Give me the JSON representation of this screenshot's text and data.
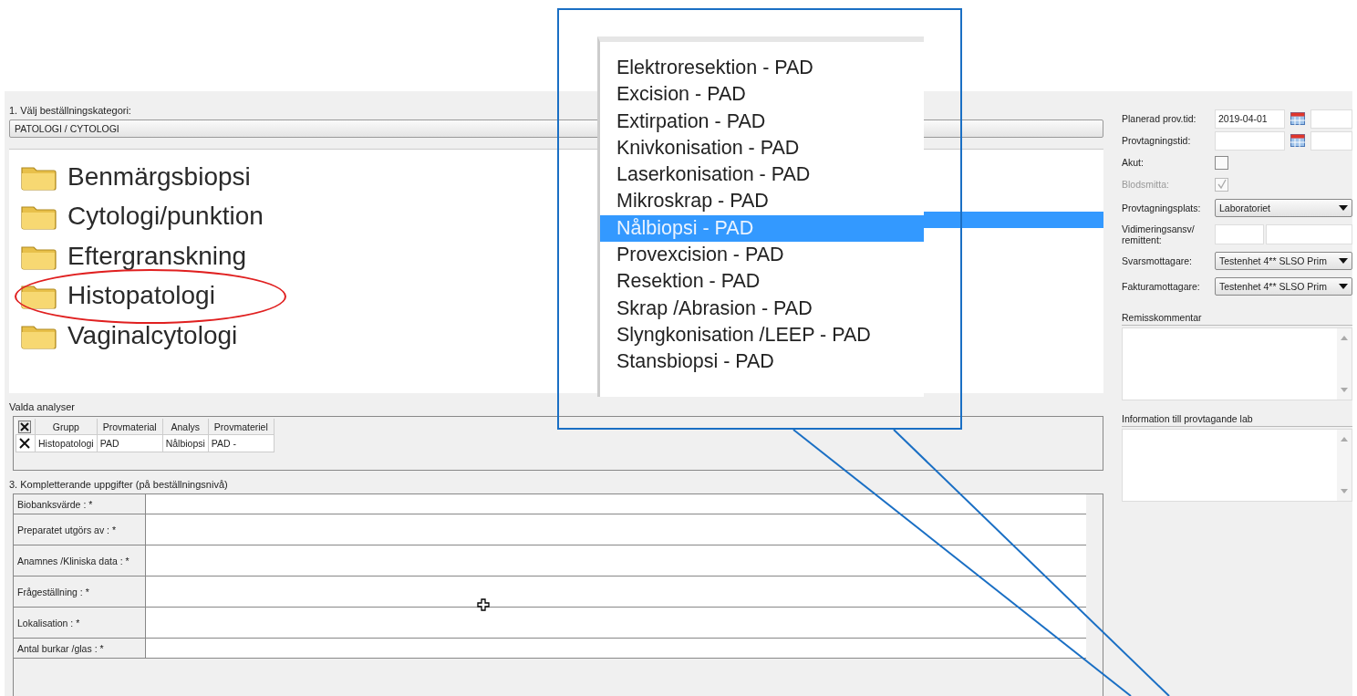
{
  "category": {
    "label": "1. Välj beställningskategori:",
    "value": "PATOLOGI / CYTOLOGI"
  },
  "folders": [
    {
      "label": "Benmärgsbiopsi",
      "circled": false
    },
    {
      "label": "Cytologi/punktion",
      "circled": false
    },
    {
      "label": "Eftergranskning",
      "circled": false
    },
    {
      "label": "Histopatologi",
      "circled": true
    },
    {
      "label": "Vaginalcytologi",
      "circled": false
    }
  ],
  "analyses": [
    {
      "label": "Elektroresektion - PAD",
      "selected": false
    },
    {
      "label": "Excision - PAD",
      "selected": false
    },
    {
      "label": "Extirpation - PAD",
      "selected": false
    },
    {
      "label": "Knivkonisation - PAD",
      "selected": false
    },
    {
      "label": "Laserkonisation - PAD",
      "selected": false
    },
    {
      "label": "Mikroskrap - PAD",
      "selected": false
    },
    {
      "label": "Nålbiopsi - PAD",
      "selected": true
    },
    {
      "label": "Provexcision - PAD",
      "selected": false
    },
    {
      "label": "Resektion - PAD",
      "selected": false
    },
    {
      "label": "Skrap /Abrasion - PAD",
      "selected": false
    },
    {
      "label": "Slyngkonisation /LEEP - PAD",
      "selected": false
    },
    {
      "label": "Stansbiopsi - PAD",
      "selected": false
    }
  ],
  "selected_analyses": {
    "title": "Valda analyser",
    "columns": [
      "Grupp",
      "Provmaterial",
      "Analys",
      "Provmateriel"
    ],
    "rows": [
      [
        "Histopatologi",
        "PAD",
        "Nålbiopsi",
        "PAD -"
      ]
    ]
  },
  "supplementary": {
    "title": "3. Kompletterande uppgifter (på beställningsnivå)",
    "fields": [
      {
        "label": "Biobanksvärde : *",
        "kind": "short"
      },
      {
        "label": "Preparatet utgörs av : *",
        "kind": "tall"
      },
      {
        "label": "Anamnes /Kliniska data : *",
        "kind": "tall"
      },
      {
        "label": "Frågeställning : *",
        "kind": "tall"
      },
      {
        "label": "Lokalisation : *",
        "kind": "tall"
      },
      {
        "label": "Antal burkar /glas : *",
        "kind": "short"
      }
    ]
  },
  "side": [
    {
      "kind": "date",
      "label": "Planerad prov.tid:",
      "value": "2019-04-01"
    },
    {
      "kind": "date",
      "label": "Provtagningstid:"
    },
    {
      "kind": "checkbox",
      "label": "Akut:",
      "checked": false,
      "disabled": false
    },
    {
      "kind": "checkbox",
      "label": "Blodsmitta:",
      "checked": true,
      "disabled": true
    },
    {
      "kind": "dropdown",
      "label": "Provtagningsplats:",
      "value": "Laboratoriet"
    },
    {
      "kind": "pair",
      "label": "Vidimeringsansv/ remittent:"
    },
    {
      "kind": "dropdown",
      "label": "Svarsmottagare:",
      "value": "Testenhet 4** SLSO Prim"
    },
    {
      "kind": "dropdown",
      "label": "Fakturamottagare:",
      "value": "Testenhet 4** SLSO Prim"
    }
  ],
  "comments": [
    {
      "label": "Remisskommentar"
    },
    {
      "label": "Information till provtagande lab"
    }
  ]
}
